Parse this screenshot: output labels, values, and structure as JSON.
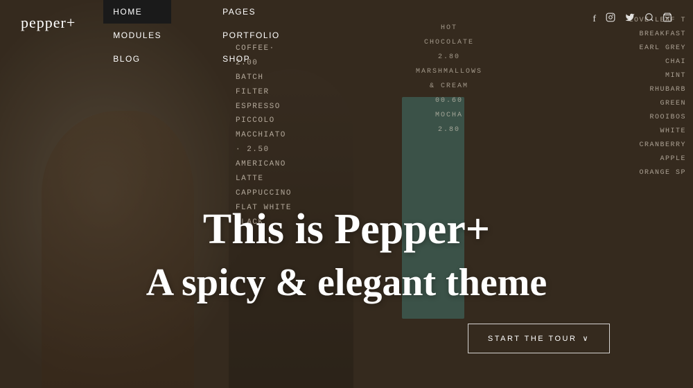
{
  "logo": {
    "text": "pepper+"
  },
  "nav": {
    "primary": [
      {
        "label": "HOME",
        "active": true
      },
      {
        "label": "MODULES",
        "active": false
      },
      {
        "label": "BLOG",
        "active": false
      }
    ],
    "secondary": [
      {
        "label": "PAGES",
        "active": false
      },
      {
        "label": "PORTFOLIO",
        "active": false
      },
      {
        "label": "SHOP",
        "active": false
      }
    ],
    "social": [
      {
        "label": "f",
        "name": "facebook"
      },
      {
        "label": "◉",
        "name": "instagram"
      },
      {
        "label": "𝕥",
        "name": "twitter"
      }
    ],
    "icons": [
      {
        "label": "⊕",
        "name": "search"
      },
      {
        "label": "🛒",
        "name": "cart"
      }
    ]
  },
  "hero": {
    "title_line1": "This is Pepper+",
    "title_line2": "A spicy & elegant theme"
  },
  "menu_board": {
    "left_items": [
      "COFFEE·",
      "2.00",
      "BATCH",
      "FILTER",
      "ESPRESSO",
      "PICCOLO",
      "MACCHIATO",
      "· 2.50",
      "AMERICANO",
      "LATTE",
      "CAPPUCCINO",
      "FLAT WHITE",
      "BLACK"
    ],
    "center_items": [
      "HOT",
      "CHOCOLATE",
      "2.80",
      "MARSHMALLOWS",
      "& CREAM",
      "00.60",
      "MOCHA",
      "2.80"
    ],
    "right_items": [
      "LOVE LEAF T",
      "BREAKFAST",
      "EARL GREY",
      "CHAI",
      "MINT",
      "RHUBARB",
      "GREEN",
      "ROOIBOS",
      "WHITE",
      "CRANBERRY",
      "APPLE",
      "ORANGE SP"
    ]
  },
  "cta": {
    "label": "START THE TOUR",
    "arrow": "∨"
  }
}
